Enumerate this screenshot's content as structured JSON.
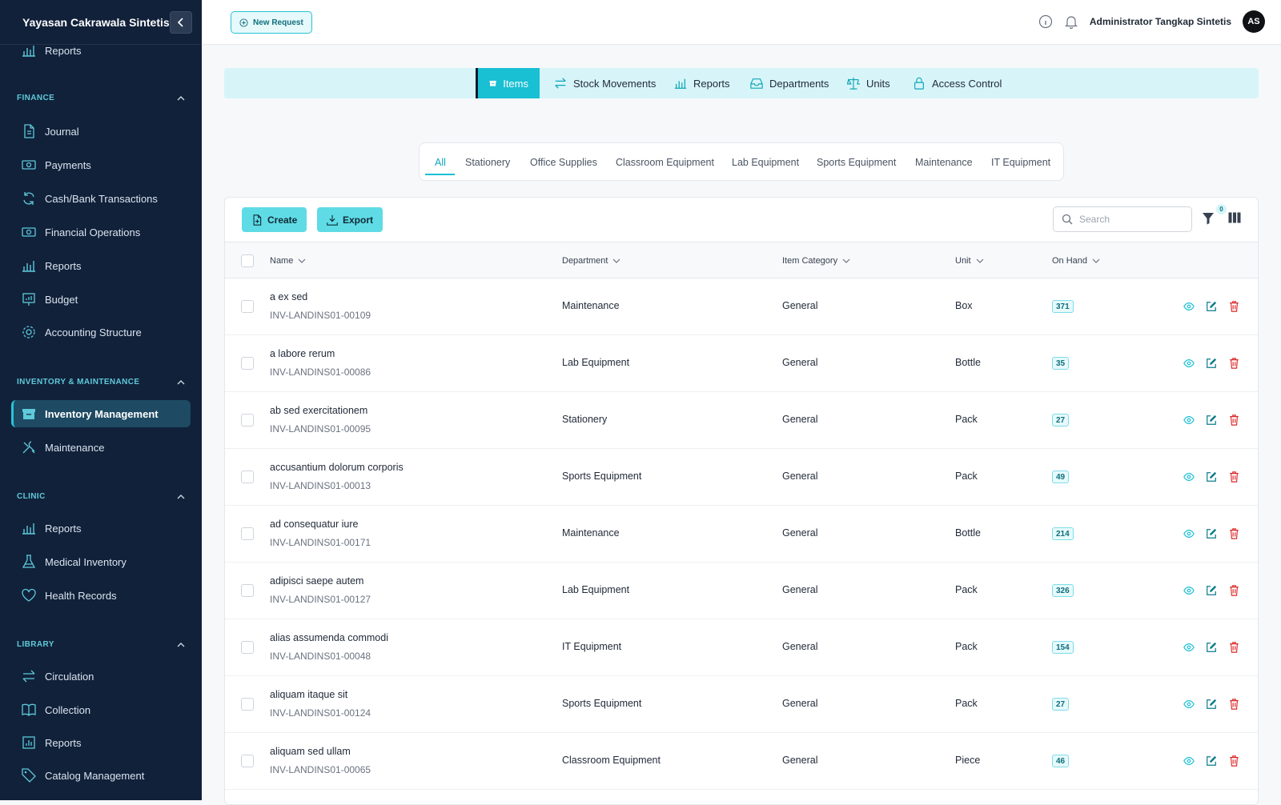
{
  "sidebar": {
    "org_name": "Yayasan Cakrawala Sintetis",
    "top_item": "Reports",
    "sections": [
      {
        "title": "FINANCE",
        "items": [
          "Journal",
          "Payments",
          "Cash/Bank Transactions",
          "Financial Operations",
          "Reports",
          "Budget",
          "Accounting Structure"
        ]
      },
      {
        "title": "INVENTORY & MAINTENANCE",
        "items": [
          "Inventory Management",
          "Maintenance"
        ]
      },
      {
        "title": "CLINIC",
        "items": [
          "Reports",
          "Medical Inventory",
          "Health Records"
        ]
      },
      {
        "title": "LIBRARY",
        "items": [
          "Circulation",
          "Collection",
          "Reports",
          "Catalog Management"
        ]
      }
    ]
  },
  "topbar": {
    "new_request": "New Request",
    "user_name": "Administrator Tangkap Sintetis",
    "avatar_initials": "AS"
  },
  "module_tabs": [
    "Items",
    "Stock Movements",
    "Reports",
    "Departments",
    "Units",
    "Access Control"
  ],
  "category_tabs": [
    "All",
    "Stationery",
    "Office Supplies",
    "Classroom Equipment",
    "Lab Equipment",
    "Sports Equipment",
    "Maintenance",
    "IT Equipment"
  ],
  "toolbar": {
    "create_label": "Create",
    "export_label": "Export",
    "search_placeholder": "Search",
    "filter_count": "0"
  },
  "table": {
    "columns": [
      "Name",
      "Department",
      "Item Category",
      "Unit",
      "On Hand"
    ],
    "rows": [
      {
        "name": "a ex sed",
        "code": "INV-LANDINS01-00109",
        "department": "Maintenance",
        "category": "General",
        "unit": "Box",
        "on_hand": "371"
      },
      {
        "name": "a labore rerum",
        "code": "INV-LANDINS01-00086",
        "department": "Lab Equipment",
        "category": "General",
        "unit": "Bottle",
        "on_hand": "35"
      },
      {
        "name": "ab sed exercitationem",
        "code": "INV-LANDINS01-00095",
        "department": "Stationery",
        "category": "General",
        "unit": "Pack",
        "on_hand": "27"
      },
      {
        "name": "accusantium dolorum corporis",
        "code": "INV-LANDINS01-00013",
        "department": "Sports Equipment",
        "category": "General",
        "unit": "Pack",
        "on_hand": "49"
      },
      {
        "name": "ad consequatur iure",
        "code": "INV-LANDINS01-00171",
        "department": "Maintenance",
        "category": "General",
        "unit": "Bottle",
        "on_hand": "214"
      },
      {
        "name": "adipisci saepe autem",
        "code": "INV-LANDINS01-00127",
        "department": "Lab Equipment",
        "category": "General",
        "unit": "Pack",
        "on_hand": "326"
      },
      {
        "name": "alias assumenda commodi",
        "code": "INV-LANDINS01-00048",
        "department": "IT Equipment",
        "category": "General",
        "unit": "Pack",
        "on_hand": "154"
      },
      {
        "name": "aliquam itaque sit",
        "code": "INV-LANDINS01-00124",
        "department": "Sports Equipment",
        "category": "General",
        "unit": "Pack",
        "on_hand": "27"
      },
      {
        "name": "aliquam sed ullam",
        "code": "INV-LANDINS01-00065",
        "department": "Classroom Equipment",
        "category": "General",
        "unit": "Piece",
        "on_hand": "46"
      }
    ]
  },
  "colors": {
    "sidebar_bg": "#11213a",
    "accent": "#19bfd3",
    "danger": "#dc2626"
  }
}
